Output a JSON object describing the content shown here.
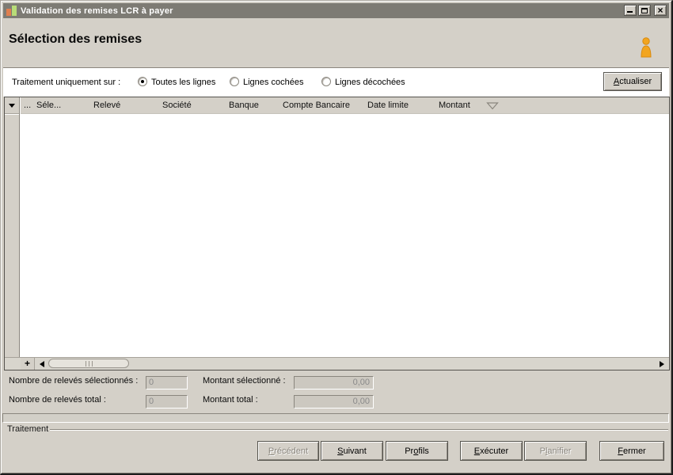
{
  "window": {
    "title": "Validation des remises LCR à payer"
  },
  "header": {
    "title": "Sélection des remises"
  },
  "toolbar": {
    "label": "Traitement uniquement sur :",
    "options": [
      {
        "label": "Toutes les lignes",
        "selected": true
      },
      {
        "label": "Lignes cochées",
        "selected": false
      },
      {
        "label": "Lignes décochées",
        "selected": false
      }
    ],
    "refresh": {
      "label": "Actualiser",
      "mnemonic": "A"
    }
  },
  "grid": {
    "columns": [
      "...",
      "Séle...",
      "Relevé",
      "Société",
      "Banque",
      "Compte Bancaire",
      "Date limite",
      "Montant"
    ],
    "rows": [],
    "add_row_label": "+"
  },
  "summary": {
    "selected_count_label": "Nombre de relevés sélectionnés :",
    "selected_count": "0",
    "selected_amount_label": "Montant sélectionné :",
    "selected_amount": "0,00",
    "total_count_label": "Nombre de relevés total :",
    "total_count": "0",
    "total_amount_label": "Montant total :",
    "total_amount": "0,00"
  },
  "process": {
    "label": "Traitement"
  },
  "footer": {
    "buttons": [
      {
        "label": "Précédent",
        "mnemonic": "P",
        "disabled": true
      },
      {
        "label": "Suivant",
        "mnemonic": "S",
        "disabled": false
      },
      {
        "label": "Profils",
        "mnemonic": "o",
        "disabled": false
      },
      {
        "label": "Exécuter",
        "mnemonic": "E",
        "disabled": false
      },
      {
        "label": "Planifier",
        "mnemonic": "l",
        "disabled": true
      },
      {
        "label": "Fermer",
        "mnemonic": "F",
        "disabled": false
      }
    ]
  },
  "colors": {
    "titlebar": "#7d7b74",
    "dialog_bg": "#d4d0c8",
    "accent_icon": "#f2a51f"
  }
}
